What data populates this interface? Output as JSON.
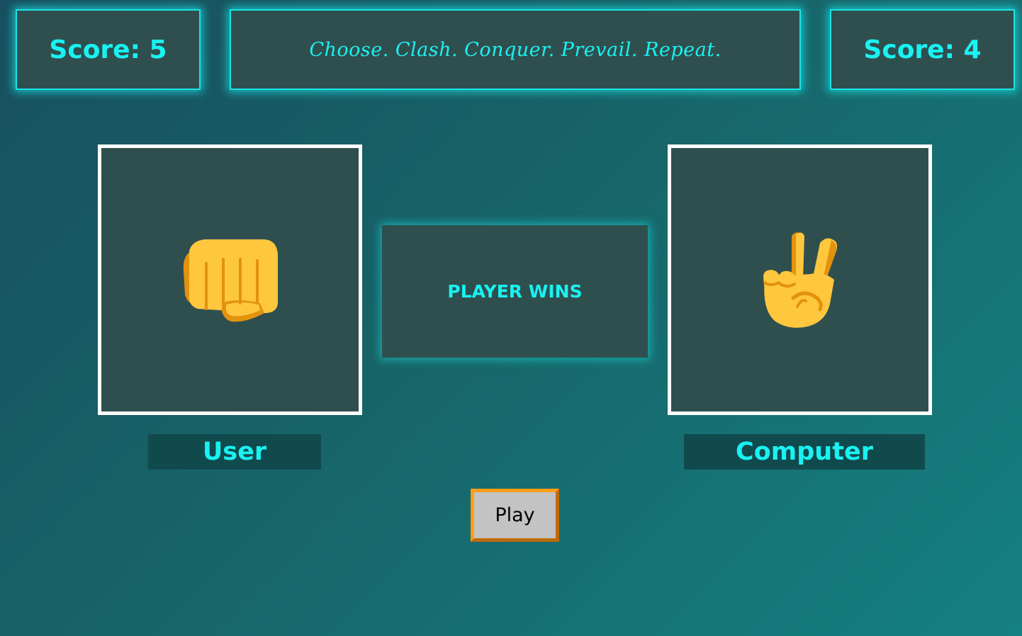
{
  "header": {
    "user_score": "Score: 5",
    "tagline": "Choose. Clash. Conquer. Prevail. Repeat.",
    "computer_score": "Score: 4"
  },
  "board": {
    "user_choice_icon": "fist-icon",
    "computer_choice_icon": "victory-hand-icon",
    "result": "PLAYER WINS",
    "user_label": "User",
    "computer_label": "Computer"
  },
  "controls": {
    "play_label": "Play"
  },
  "colors": {
    "accent": "#19f2f2",
    "panel": "#2f4f4e",
    "label_bg": "#114a4d",
    "play_border": "#ff9c1a",
    "play_bg": "#c3c3c3"
  }
}
